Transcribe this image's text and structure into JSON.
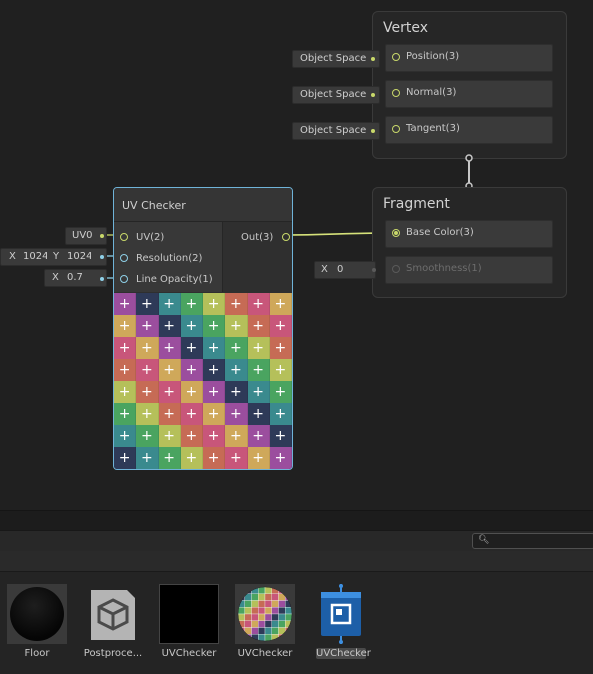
{
  "vertex": {
    "title": "Vertex",
    "blocks": [
      {
        "label": "Position(3)",
        "space": "Object Space"
      },
      {
        "label": "Normal(3)",
        "space": "Object Space"
      },
      {
        "label": "Tangent(3)",
        "space": "Object Space"
      }
    ]
  },
  "fragment": {
    "title": "Fragment",
    "blocks": [
      {
        "label": "Base Color(3)"
      },
      {
        "label": "Smoothness(1)",
        "x_label": "X",
        "x_value": "0"
      }
    ]
  },
  "uv_node": {
    "title": "UV Checker",
    "inputs": [
      {
        "label": "UV(2)",
        "value": "UV0"
      },
      {
        "label": "Resolution(2)",
        "x_label": "X",
        "x_value": "1024",
        "y_label": "Y",
        "y_value": "1024"
      },
      {
        "label": "Line Opacity(1)",
        "x_label": "X",
        "x_value": "0.7"
      }
    ],
    "output": "Out(3)",
    "preview_symbol": "+"
  },
  "assets": [
    {
      "name": "Floor",
      "icon": "black-sphere-material-icon"
    },
    {
      "name": "Postproce...",
      "icon": "cube-prefab-icon"
    },
    {
      "name": "UVChecker",
      "icon": "black-texture-icon"
    },
    {
      "name": "UVChecker",
      "icon": "checker-sphere-material-icon"
    },
    {
      "name": "UVChecker",
      "icon": "shadergraph-asset-icon",
      "selected": true
    }
  ],
  "colors": {
    "accent": "#c8d86a",
    "selection": "#6fb3d8",
    "checker": [
      "#9b4e9e",
      "#2e3a58",
      "#3a8a8e",
      "#4aa460",
      "#b5c05a",
      "#c66b55",
      "#c8567a",
      "#cfa85a"
    ]
  }
}
